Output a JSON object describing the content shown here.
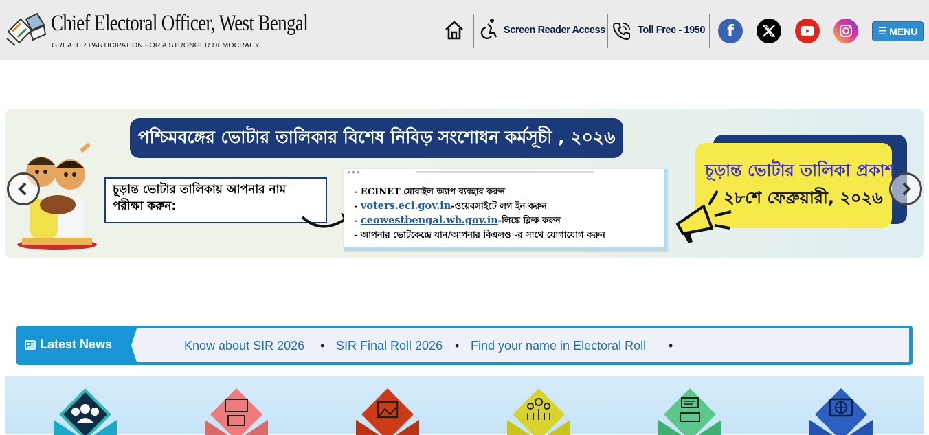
{
  "header": {
    "title": "Chief Electoral Officer, West Bengal",
    "subtitle": "GREATER PARTICIPATION FOR A STRONGER DEMOCRACY",
    "screen_reader": "Screen Reader Access",
    "toll_free": "Toll Free - 1950",
    "menu_label": "MENU",
    "social": [
      "facebook-icon",
      "x-icon",
      "youtube-icon",
      "instagram-icon"
    ]
  },
  "banner": {
    "title": "পশ্চিমবঙ্গের ভোটার তালিকার বিশেষ নিবিড় সংশোধন কর্মসূচী , ২০২৬",
    "check_heading": "চূড়ান্ত ভোটার তালিকায় আপনার নাম পরীক্ষা করুন:",
    "lines": [
      {
        "prefix": "- ECINET মোবাইল অ্যাপ ব্যবহার করুন",
        "link": "",
        "suffix": ""
      },
      {
        "prefix": "- ",
        "link": "voters.eci.gov.in",
        "suffix": "-ওয়েবসাইটে লগ ইন করুন"
      },
      {
        "prefix": "- ",
        "link": "ceowestbengal.wb.gov.in",
        "suffix": "-লিঙ্কে ক্লিক করুন"
      },
      {
        "prefix": "- আপনার ভোটকেন্দ্রে যান/আপনার বিএলও -র সাথে যোগাযোগ করুন",
        "link": "",
        "suffix": ""
      }
    ],
    "publish_line1": "চূড়ান্ত ভোটার তালিকা প্রকাশ",
    "publish_line2": "২৮শে ফেব্রুয়ারী, ২০২৬"
  },
  "news": {
    "label": "Latest News",
    "items": [
      "Know about SIR 2026",
      "SIR Final Roll 2026",
      "Find your name in Electoral Roll"
    ]
  },
  "colors": {
    "header_bg": "#ebebeb",
    "primary_navy": "#1a3a7a",
    "news_blue": "#1795d6",
    "menu_blue": "#2e8ccf",
    "publish_yellow": "#f6e94a"
  },
  "tiles": [
    "group-icon",
    "vote-icon",
    "gallery-icon",
    "people-icon",
    "ballot-icon",
    "web-icon"
  ]
}
